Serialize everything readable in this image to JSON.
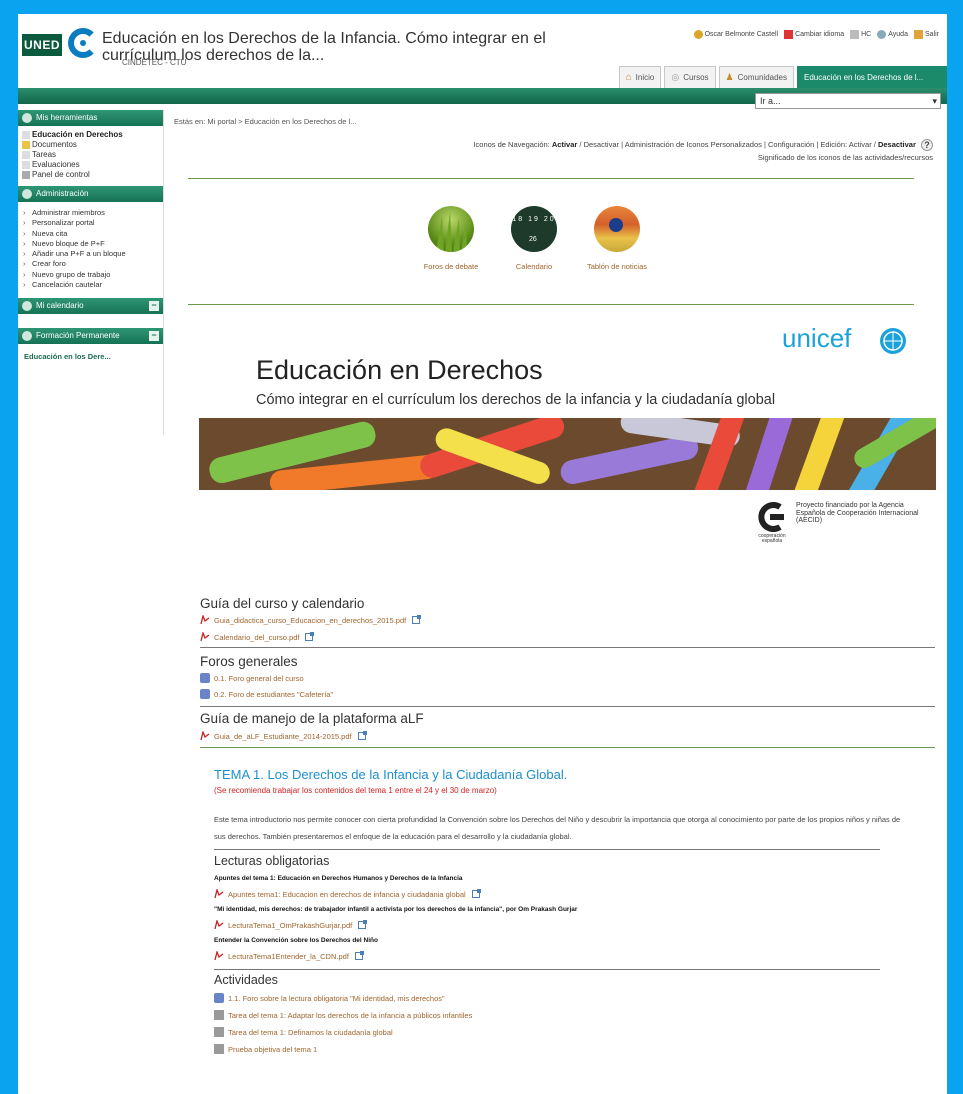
{
  "header": {
    "logo_text": "UNED",
    "title": "Educación en los Derechos de la Infancia. Cómo integrar en el currículum los derechos de la...",
    "subtitle": "CINDETEC - CTU",
    "toplinks": [
      {
        "label": "Oscar Belmonte Castell",
        "icon": "user-icon"
      },
      {
        "label": "Cambiar idioma",
        "icon": "flag-icon"
      },
      {
        "label": "HC",
        "icon": "hc-icon"
      },
      {
        "label": "Ayuda",
        "icon": "help-icon"
      },
      {
        "label": "Salir",
        "icon": "exit-icon"
      }
    ],
    "tabs": [
      {
        "label": "Inicio",
        "icon": "home-icon"
      },
      {
        "label": "Cursos",
        "icon": "courses-icon"
      },
      {
        "label": "Comunidades",
        "icon": "communities-icon"
      },
      {
        "label": "Educación en los Derechos de l...",
        "active": true
      }
    ],
    "ira_select": "Ir a..."
  },
  "sidebar": {
    "mis_herramientas": {
      "title": "Mis herramientas",
      "items": [
        {
          "label": "Educación en Derechos",
          "bold": true
        },
        {
          "label": "Documentos"
        },
        {
          "label": "Tareas"
        },
        {
          "label": "Evaluaciones"
        },
        {
          "label": "Panel de control"
        }
      ]
    },
    "administracion": {
      "title": "Administración",
      "items": [
        "Administrar miembros",
        "Personalizar portal",
        "Nueva cita",
        "Nuevo bloque de P+F",
        "Añadir una P+F a un bloque",
        "Crear foro",
        "Nuevo grupo de trabajo",
        "Cancelación cautelar"
      ]
    },
    "mi_calendario": "Mi calendario",
    "formacion": {
      "title": "Formación Permanente",
      "link": "Educación en los Dere..."
    }
  },
  "main": {
    "breadcrumb": "Estás en: Mi portal > Educación en los Derechos de l...",
    "nav_icons": {
      "line1_prefix": "Iconos de Navegación:",
      "activar": "Activar",
      "desactivar": "Desactivar",
      "admin_icons": "Administración de Iconos Personalizados",
      "config": "Configuración",
      "edicion_prefix": "Edición:",
      "edicion_activar": "Activar",
      "edicion_desactivar": "Desactivar",
      "line2": "Significado de los iconos de las actividades/recursos"
    },
    "quick_tools": [
      {
        "label": "Foros de debate",
        "icon": "forum-grass-icon"
      },
      {
        "label": "Calendario",
        "icon": "calendar-icon"
      },
      {
        "label": "Tablón de noticias",
        "icon": "news-board-icon"
      }
    ],
    "calendar_numbers": [
      "18",
      "19",
      "20",
      "26"
    ],
    "unicef": "unicef",
    "course_title": "Educación en Derechos",
    "course_subtitle": "Cómo integrar en el currículum los derechos de la infancia y la ciudadanía global",
    "coop": {
      "logo_label": "cooperación española",
      "text": "Proyecto financiado por la Agencia Española de Cooperación Internacional (AECID)"
    },
    "sections": [
      {
        "title": "Guía del curso y calendario",
        "items": [
          {
            "label": "Guia_didactica_curso_Educacion_en_derechos_2015.pdf",
            "icon": "pdf-icon"
          },
          {
            "label": "Calendario_del_curso.pdf",
            "icon": "pdf-icon"
          }
        ]
      },
      {
        "title": "Foros generales",
        "items": [
          {
            "label": "0.1. Foro general del curso",
            "icon": "forum-icon"
          },
          {
            "label": "0.2. Foro de estudiantes \"Cafetería\"",
            "icon": "forum-icon"
          }
        ]
      },
      {
        "title": "Guía de manejo de la plataforma aLF",
        "items": [
          {
            "label": "Guia_de_aLF_Estudiante_2014-2015.pdf",
            "icon": "pdf-icon"
          }
        ]
      }
    ],
    "tema": {
      "title": "TEMA 1. Los Derechos de la Infancia y la Ciudadanía Global.",
      "note": "(Se recomienda trabajar los contenidos del tema 1 entre el 24 y el 30 de marzo)",
      "description": "Este tema introductorio nos permite conocer con cierta profundidad la Convención sobre los Derechos del Niño y descubrir la importancia que otorga al conocimiento por parte de los propios niños y niñas de sus derechos. También presentaremos el enfoque de la educación para el desarrollo y la ciudadanía global.",
      "lecturas": {
        "title": "Lecturas obligatorias",
        "blocks": [
          {
            "heading": "Apuntes del tema 1: Educación en Derechos Humanos y Derechos de la Infancia",
            "file": "Apuntes tema1: Educacion en derechos de infancia y ciudadania global"
          },
          {
            "heading": "\"Mi identidad, mis derechos: de trabajador infantil a activista por los derechos de la infancia\", por Om Prakash Gurjar",
            "file": "LecturaTema1_OmPrakashGurjar.pdf"
          },
          {
            "heading": "Entender la Convención sobre los Derechos del Niño",
            "file": "LecturaTema1Entender_la_CDN.pdf"
          }
        ]
      },
      "actividades": {
        "title": "Actividades",
        "items": [
          {
            "label": "1.1. Foro sobre la lectura obligatoria \"Mi identidad, mis derechos\"",
            "icon": "forum-icon"
          },
          {
            "label": "Tarea del tema 1: Adaptar los derechos de la infancia a públicos infantiles",
            "icon": "task-icon"
          },
          {
            "label": "Tarea del tema 1: Definamos la ciudadanía global",
            "icon": "task-icon"
          },
          {
            "label": "Prueba objetiva del tema 1",
            "icon": "test-icon"
          }
        ]
      }
    }
  },
  "colors": {
    "background": "#0aa3f0",
    "uned_green": "#1b8a6a",
    "link_brown": "#a0652e",
    "tema_blue": "#1c8fd0",
    "note_red": "#d42020",
    "unicef_blue": "#1ca2db"
  }
}
